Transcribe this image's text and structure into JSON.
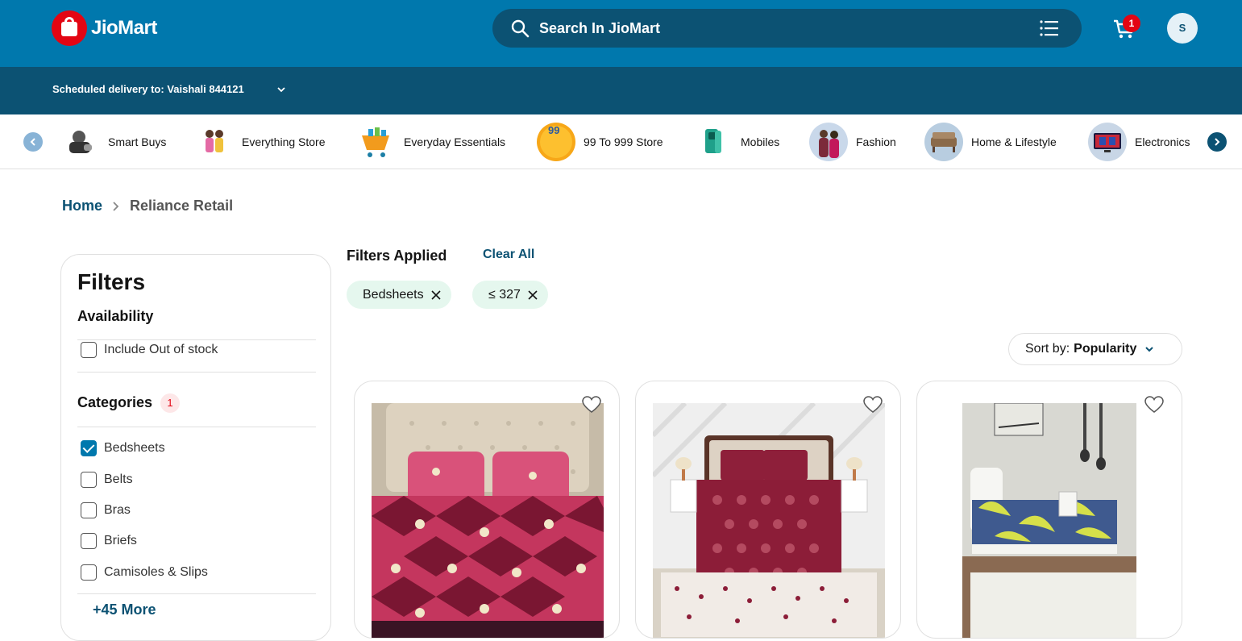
{
  "header": {
    "brand": "JioMart",
    "search_placeholder": "Search In JioMart",
    "cart_count": "1",
    "avatar_initial": "S",
    "delivery_text": "Scheduled delivery to: Vaishali 844121"
  },
  "categories": [
    {
      "label": "Smart Buys",
      "icon": "smart-buys-icon"
    },
    {
      "label": "Everything Store",
      "icon": "everything-store-icon"
    },
    {
      "label": "Everyday Essentials",
      "icon": "everyday-essentials-icon"
    },
    {
      "label": "99 To 999 Store",
      "icon": "99-store-icon",
      "badge": "99"
    },
    {
      "label": "Mobiles",
      "icon": "mobiles-icon"
    },
    {
      "label": "Fashion",
      "icon": "fashion-icon"
    },
    {
      "label": "Home & Lifestyle",
      "icon": "home-lifestyle-icon"
    },
    {
      "label": "Electronics",
      "icon": "electronics-icon"
    }
  ],
  "breadcrumb": {
    "home": "Home",
    "current": "Reliance Retail"
  },
  "filters": {
    "title": "Filters",
    "availability": {
      "heading": "Availability",
      "options": [
        {
          "label": "Include Out of stock",
          "checked": false
        }
      ]
    },
    "categories": {
      "heading": "Categories",
      "selected_count": "1",
      "options": [
        {
          "label": "Bedsheets",
          "checked": true
        },
        {
          "label": "Belts",
          "checked": false
        },
        {
          "label": "Bras",
          "checked": false
        },
        {
          "label": "Briefs",
          "checked": false
        },
        {
          "label": "Camisoles & Slips",
          "checked": false
        }
      ],
      "more": "+45 More"
    }
  },
  "applied": {
    "title": "Filters Applied",
    "clear_all": "Clear All",
    "chips": [
      "Bedsheets",
      "≤ 327"
    ]
  },
  "sort": {
    "label": "Sort by:",
    "value": "Popularity"
  },
  "colors": {
    "primary": "#0078ad",
    "dark": "#0c5273",
    "accent": "#e30513",
    "chip_bg": "#e5f7ee"
  }
}
